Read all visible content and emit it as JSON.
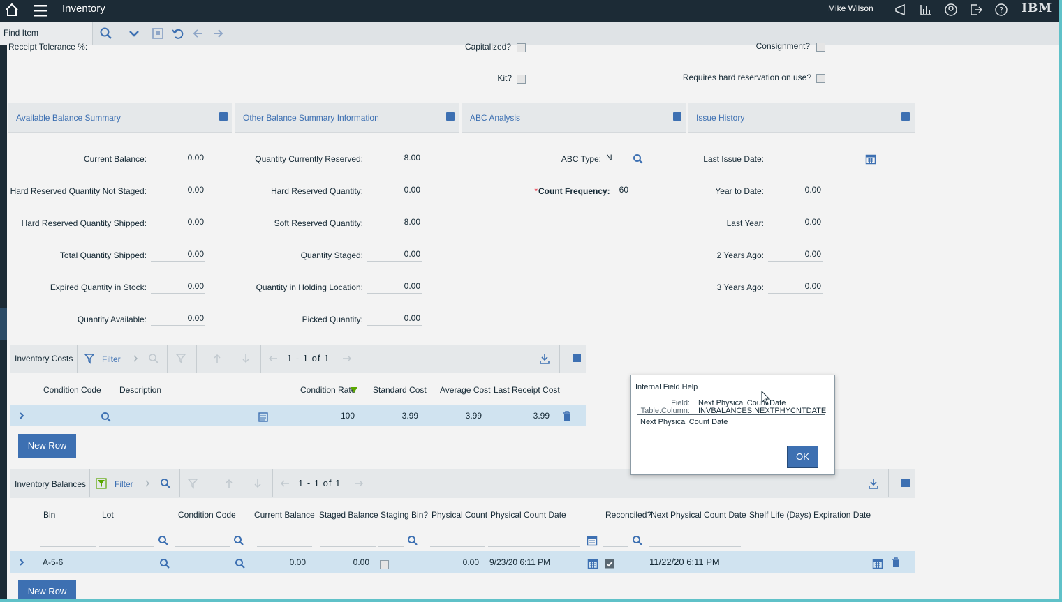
{
  "app": {
    "title": "Inventory",
    "user": "Mike Wilson",
    "brand": "IBM"
  },
  "toolbar": {
    "find_placeholder": "Find Item"
  },
  "top_fields": {
    "receipt_tolerance": "Receipt Tolerance %:",
    "capitalized": "Capitalized?",
    "consignment": "Consignment?",
    "kit": "Kit?",
    "hard_reservation": "Requires hard reservation on use?"
  },
  "sections": {
    "available": "Available Balance Summary",
    "other": "Other Balance Summary Information",
    "abc": "ABC Analysis",
    "issue": "Issue History"
  },
  "available": [
    {
      "label": "Current Balance:",
      "value": "0.00"
    },
    {
      "label": "Hard Reserved Quantity Not Staged:",
      "value": "0.00"
    },
    {
      "label": "Hard Reserved Quantity Shipped:",
      "value": "0.00"
    },
    {
      "label": "Total Quantity Shipped:",
      "value": "0.00"
    },
    {
      "label": "Expired Quantity in Stock:",
      "value": "0.00"
    },
    {
      "label": "Quantity Available:",
      "value": "0.00"
    }
  ],
  "other": [
    {
      "label": "Quantity Currently Reserved:",
      "value": "8.00"
    },
    {
      "label": "Hard Reserved Quantity:",
      "value": "0.00"
    },
    {
      "label": "Soft Reserved Quantity:",
      "value": "8.00"
    },
    {
      "label": "Quantity Staged:",
      "value": "0.00"
    },
    {
      "label": "Quantity in Holding Location:",
      "value": "0.00"
    },
    {
      "label": "Picked Quantity:",
      "value": "0.00"
    }
  ],
  "abc": {
    "type_label": "ABC Type:",
    "type_value": "N",
    "required": "*",
    "count_label": "Count Frequency:",
    "count_value": "60"
  },
  "issue": {
    "last_issue_label": "Last Issue Date:",
    "rows": [
      {
        "label": "Year to Date:",
        "value": "0.00"
      },
      {
        "label": "Last Year:",
        "value": "0.00"
      },
      {
        "label": "2 Years Ago:",
        "value": "0.00"
      },
      {
        "label": "3 Years Ago:",
        "value": "0.00"
      }
    ]
  },
  "costs": {
    "title": "Inventory Costs",
    "filter": "Filter",
    "pager": "1 - 1 of 1",
    "columns": [
      "Condition Code",
      "Description",
      "Condition Rate",
      "Standard Cost",
      "Average Cost",
      "Last Receipt Cost"
    ],
    "row": {
      "rate": "100",
      "standard": "3.99",
      "average": "3.99",
      "last": "3.99"
    },
    "new_row": "New Row"
  },
  "balances": {
    "title": "Inventory Balances",
    "filter": "Filter",
    "pager": "1 - 1 of 1",
    "columns": [
      "Bin",
      "Lot",
      "Condition Code",
      "Current Balance",
      "Staged Balance",
      "Staging Bin?",
      "Physical Count",
      "Physical Count Date",
      "Reconciled?",
      "Next Physical Count Date",
      "Shelf Life (Days)",
      "Expiration Date"
    ],
    "row": {
      "bin": "A-5-6",
      "current": "0.00",
      "staged": "0.00",
      "physical": "0.00",
      "count_date": "9/23/20 6:11 PM",
      "next_date": "11/22/20 6:11 PM"
    },
    "new_row": "New Row"
  },
  "dialog": {
    "title": "Internal Field Help",
    "field_label": "Field:",
    "field_value": "Next Physical Count Date",
    "column_label": "Table.Column:",
    "column_value": "INVBALANCES.NEXTPHYCNTDATE",
    "description": "Next Physical Count Date",
    "ok": "OK"
  }
}
